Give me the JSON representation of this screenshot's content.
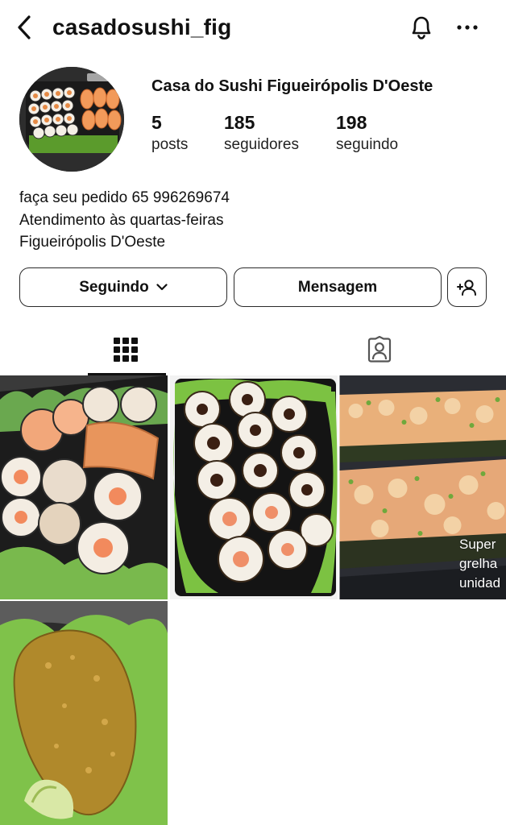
{
  "header": {
    "username": "casadosushi_fig",
    "back_icon": "chevron-left-icon",
    "bell_icon": "bell-icon",
    "more_icon": "more-horizontal-icon"
  },
  "profile": {
    "display_name": "Casa do Sushi Figueirópolis D'Oeste",
    "stats": [
      {
        "value": "5",
        "label": "posts"
      },
      {
        "value": "185",
        "label": "seguidores"
      },
      {
        "value": "198",
        "label": "seguindo"
      }
    ],
    "bio": [
      "faça seu pedido 65 996269674",
      "Atendimento às quartas-feiras",
      "Figueirópolis D'Oeste"
    ]
  },
  "actions": {
    "following_label": "Seguindo",
    "message_label": "Mensagem",
    "add_user_icon": "add-user-icon"
  },
  "tabs": [
    {
      "name": "grid",
      "icon": "grid-icon",
      "active": true
    },
    {
      "name": "tagged",
      "icon": "tagged-person-icon",
      "active": false
    }
  ],
  "posts": [
    {
      "content": "sushi platter photo"
    },
    {
      "content": "hot roll platter photo"
    },
    {
      "content": "grilled sushi photo",
      "overlay_text": [
        "Super",
        "grelha",
        "unidad"
      ]
    },
    {
      "content": "breaded fried item photo"
    }
  ],
  "colors": {
    "text": "#111111",
    "border": "#2a2a2a",
    "background": "#ffffff"
  }
}
